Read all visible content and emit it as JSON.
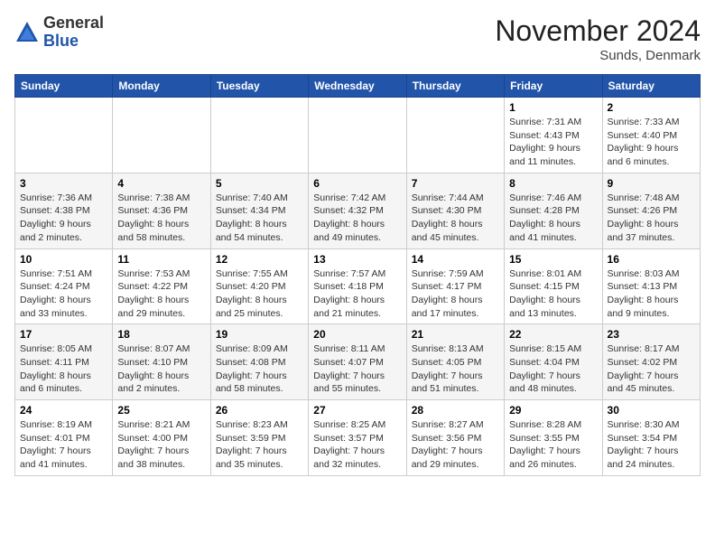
{
  "header": {
    "logo_general": "General",
    "logo_blue": "Blue",
    "month_title": "November 2024",
    "location": "Sunds, Denmark"
  },
  "weekdays": [
    "Sunday",
    "Monday",
    "Tuesday",
    "Wednesday",
    "Thursday",
    "Friday",
    "Saturday"
  ],
  "weeks": [
    [
      {
        "day": "",
        "info": ""
      },
      {
        "day": "",
        "info": ""
      },
      {
        "day": "",
        "info": ""
      },
      {
        "day": "",
        "info": ""
      },
      {
        "day": "",
        "info": ""
      },
      {
        "day": "1",
        "info": "Sunrise: 7:31 AM\nSunset: 4:43 PM\nDaylight: 9 hours and 11 minutes."
      },
      {
        "day": "2",
        "info": "Sunrise: 7:33 AM\nSunset: 4:40 PM\nDaylight: 9 hours and 6 minutes."
      }
    ],
    [
      {
        "day": "3",
        "info": "Sunrise: 7:36 AM\nSunset: 4:38 PM\nDaylight: 9 hours and 2 minutes."
      },
      {
        "day": "4",
        "info": "Sunrise: 7:38 AM\nSunset: 4:36 PM\nDaylight: 8 hours and 58 minutes."
      },
      {
        "day": "5",
        "info": "Sunrise: 7:40 AM\nSunset: 4:34 PM\nDaylight: 8 hours and 54 minutes."
      },
      {
        "day": "6",
        "info": "Sunrise: 7:42 AM\nSunset: 4:32 PM\nDaylight: 8 hours and 49 minutes."
      },
      {
        "day": "7",
        "info": "Sunrise: 7:44 AM\nSunset: 4:30 PM\nDaylight: 8 hours and 45 minutes."
      },
      {
        "day": "8",
        "info": "Sunrise: 7:46 AM\nSunset: 4:28 PM\nDaylight: 8 hours and 41 minutes."
      },
      {
        "day": "9",
        "info": "Sunrise: 7:48 AM\nSunset: 4:26 PM\nDaylight: 8 hours and 37 minutes."
      }
    ],
    [
      {
        "day": "10",
        "info": "Sunrise: 7:51 AM\nSunset: 4:24 PM\nDaylight: 8 hours and 33 minutes."
      },
      {
        "day": "11",
        "info": "Sunrise: 7:53 AM\nSunset: 4:22 PM\nDaylight: 8 hours and 29 minutes."
      },
      {
        "day": "12",
        "info": "Sunrise: 7:55 AM\nSunset: 4:20 PM\nDaylight: 8 hours and 25 minutes."
      },
      {
        "day": "13",
        "info": "Sunrise: 7:57 AM\nSunset: 4:18 PM\nDaylight: 8 hours and 21 minutes."
      },
      {
        "day": "14",
        "info": "Sunrise: 7:59 AM\nSunset: 4:17 PM\nDaylight: 8 hours and 17 minutes."
      },
      {
        "day": "15",
        "info": "Sunrise: 8:01 AM\nSunset: 4:15 PM\nDaylight: 8 hours and 13 minutes."
      },
      {
        "day": "16",
        "info": "Sunrise: 8:03 AM\nSunset: 4:13 PM\nDaylight: 8 hours and 9 minutes."
      }
    ],
    [
      {
        "day": "17",
        "info": "Sunrise: 8:05 AM\nSunset: 4:11 PM\nDaylight: 8 hours and 6 minutes."
      },
      {
        "day": "18",
        "info": "Sunrise: 8:07 AM\nSunset: 4:10 PM\nDaylight: 8 hours and 2 minutes."
      },
      {
        "day": "19",
        "info": "Sunrise: 8:09 AM\nSunset: 4:08 PM\nDaylight: 7 hours and 58 minutes."
      },
      {
        "day": "20",
        "info": "Sunrise: 8:11 AM\nSunset: 4:07 PM\nDaylight: 7 hours and 55 minutes."
      },
      {
        "day": "21",
        "info": "Sunrise: 8:13 AM\nSunset: 4:05 PM\nDaylight: 7 hours and 51 minutes."
      },
      {
        "day": "22",
        "info": "Sunrise: 8:15 AM\nSunset: 4:04 PM\nDaylight: 7 hours and 48 minutes."
      },
      {
        "day": "23",
        "info": "Sunrise: 8:17 AM\nSunset: 4:02 PM\nDaylight: 7 hours and 45 minutes."
      }
    ],
    [
      {
        "day": "24",
        "info": "Sunrise: 8:19 AM\nSunset: 4:01 PM\nDaylight: 7 hours and 41 minutes."
      },
      {
        "day": "25",
        "info": "Sunrise: 8:21 AM\nSunset: 4:00 PM\nDaylight: 7 hours and 38 minutes."
      },
      {
        "day": "26",
        "info": "Sunrise: 8:23 AM\nSunset: 3:59 PM\nDaylight: 7 hours and 35 minutes."
      },
      {
        "day": "27",
        "info": "Sunrise: 8:25 AM\nSunset: 3:57 PM\nDaylight: 7 hours and 32 minutes."
      },
      {
        "day": "28",
        "info": "Sunrise: 8:27 AM\nSunset: 3:56 PM\nDaylight: 7 hours and 29 minutes."
      },
      {
        "day": "29",
        "info": "Sunrise: 8:28 AM\nSunset: 3:55 PM\nDaylight: 7 hours and 26 minutes."
      },
      {
        "day": "30",
        "info": "Sunrise: 8:30 AM\nSunset: 3:54 PM\nDaylight: 7 hours and 24 minutes."
      }
    ]
  ]
}
